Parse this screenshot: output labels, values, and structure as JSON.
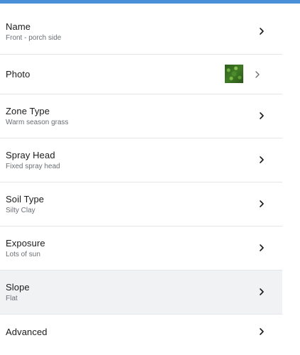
{
  "zone_settings": {
    "rows": [
      {
        "title": "Name",
        "value": "Front - porch side"
      },
      {
        "title": "Photo",
        "thumbnail": "grass-photo"
      },
      {
        "title": "Zone Type",
        "value": "Warm season grass"
      },
      {
        "title": "Spray Head",
        "value": "Fixed spray head"
      },
      {
        "title": "Soil Type",
        "value": "Silty Clay"
      },
      {
        "title": "Exposure",
        "value": "Lots of sun"
      },
      {
        "title": "Slope",
        "value": "Flat"
      },
      {
        "title": "Advanced"
      }
    ]
  },
  "icons": {
    "chevron": "chevron-right-icon"
  },
  "colors": {
    "accent_bar": "#4a90d9",
    "highlight_row": "#f1f2f4",
    "divider": "#e3e5e8",
    "subtitle_text": "#6b6f74"
  }
}
